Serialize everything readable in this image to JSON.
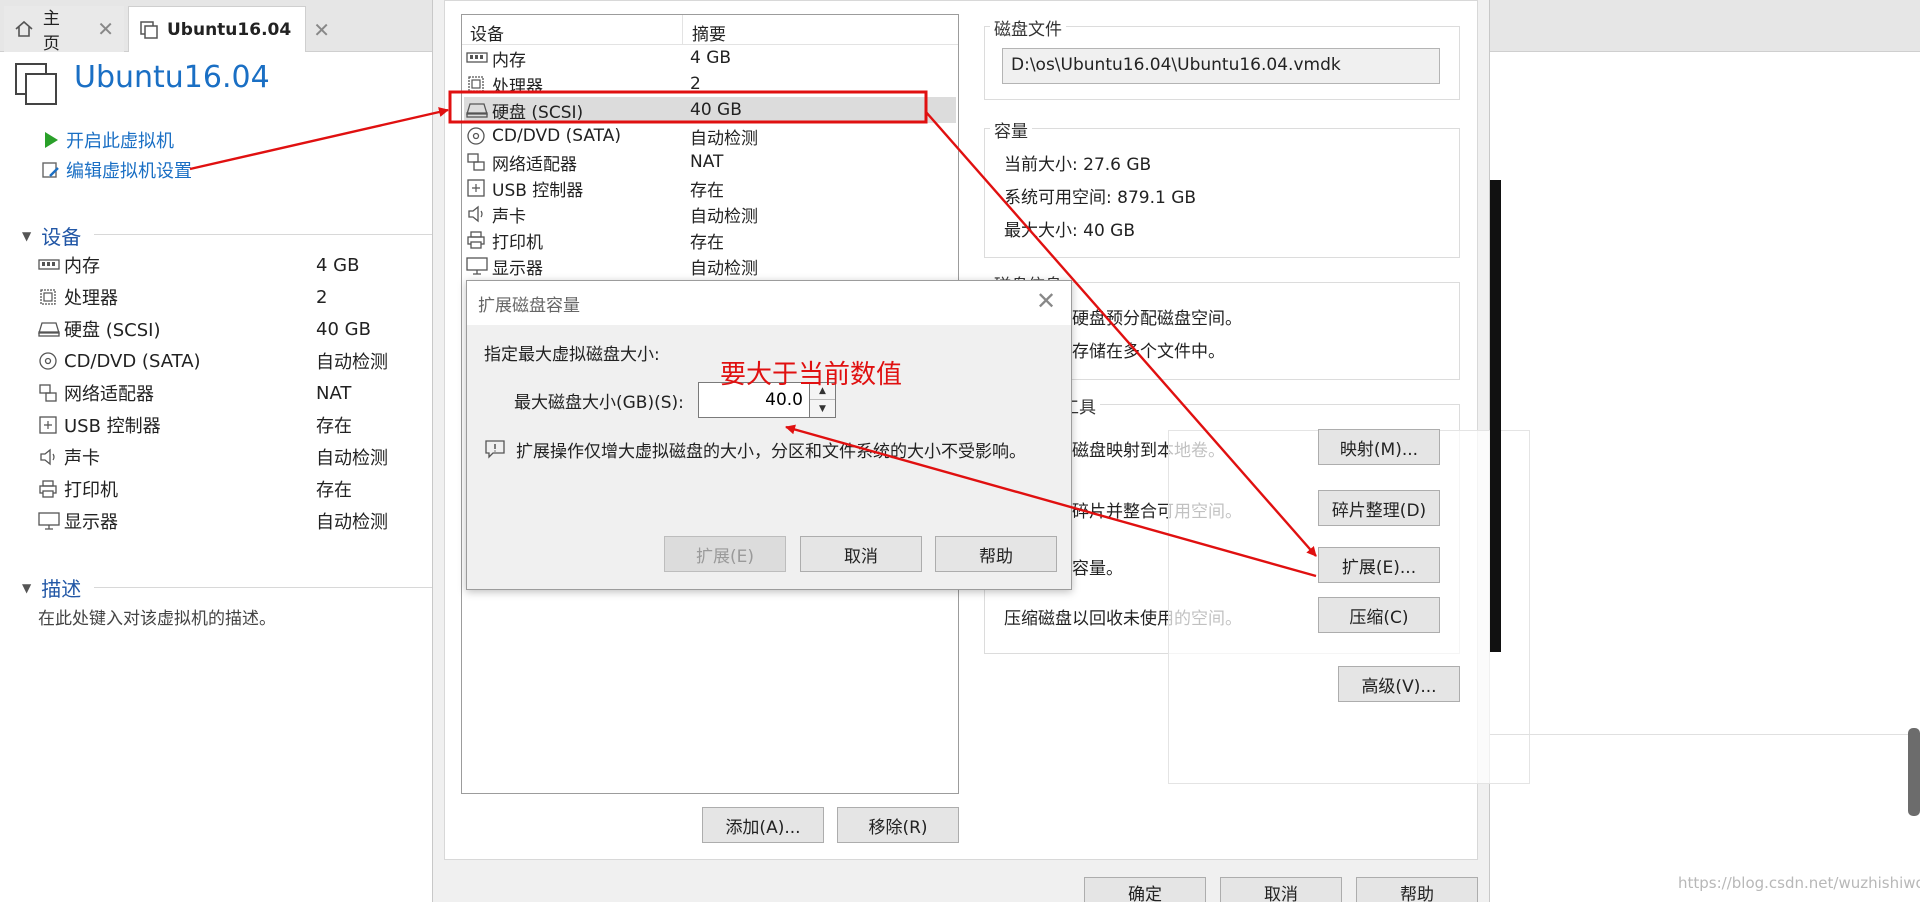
{
  "tabs": [
    {
      "label": "主页",
      "icon": "home-icon"
    },
    {
      "label": "Ubuntu16.04",
      "icon": "vm-icon"
    }
  ],
  "vm": {
    "title": "Ubuntu16.04",
    "actions": [
      {
        "label": "开启此虚拟机",
        "icon": "play-icon"
      },
      {
        "label": "编辑虚拟机设置",
        "icon": "settings-icon"
      }
    ],
    "devices_title": "设备",
    "devices": [
      {
        "name": "内存",
        "value": "4 GB",
        "icon": "memory-icon"
      },
      {
        "name": "处理器",
        "value": "2",
        "icon": "cpu-icon"
      },
      {
        "name": "硬盘 (SCSI)",
        "value": "40 GB",
        "icon": "harddisk-icon"
      },
      {
        "name": "CD/DVD (SATA)",
        "value": "自动检测",
        "icon": "cd-icon"
      },
      {
        "name": "网络适配器",
        "value": "NAT",
        "icon": "network-icon"
      },
      {
        "name": "USB 控制器",
        "value": "存在",
        "icon": "usb-icon"
      },
      {
        "name": "声卡",
        "value": "自动检测",
        "icon": "sound-icon"
      },
      {
        "name": "打印机",
        "value": "存在",
        "icon": "printer-icon"
      },
      {
        "name": "显示器",
        "value": "自动检测",
        "icon": "display-icon"
      }
    ],
    "description_title": "描述",
    "description_placeholder": "在此处键入对该虚拟机的描述。"
  },
  "settings": {
    "list_header": {
      "device": "设备",
      "summary": "摘要"
    },
    "devices": [
      {
        "name": "内存",
        "value": "4 GB",
        "icon": "memory-icon"
      },
      {
        "name": "处理器",
        "value": "2",
        "icon": "cpu-icon"
      },
      {
        "name": "硬盘 (SCSI)",
        "value": "40 GB",
        "icon": "harddisk-icon",
        "selected": true
      },
      {
        "name": "CD/DVD (SATA)",
        "value": "自动检测",
        "icon": "cd-icon"
      },
      {
        "name": "网络适配器",
        "value": "NAT",
        "icon": "network-icon"
      },
      {
        "name": "USB 控制器",
        "value": "存在",
        "icon": "usb-icon"
      },
      {
        "name": "声卡",
        "value": "自动检测",
        "icon": "sound-icon"
      },
      {
        "name": "打印机",
        "value": "存在",
        "icon": "printer-icon"
      },
      {
        "name": "显示器",
        "value": "自动检测",
        "icon": "display-icon"
      }
    ],
    "add_button": "添加(A)...",
    "remove_button": "移除(R)",
    "disk_file_title": "磁盘文件",
    "disk_file_path": "D:\\os\\Ubuntu16.04\\Ubuntu16.04.vmdk",
    "capacity_title": "容量",
    "current_size": "当前大小: 27.6 GB",
    "free_space": "系统可用空间: 879.1 GB",
    "max_size": "最大大小: 40 GB",
    "disk_info_title": "磁盘信息",
    "disk_info_1": "没有为此硬盘预分配磁盘空间。",
    "disk_info_2": "硬盘内容存储在多个文件中。",
    "disk_tools_title": "磁盘实用工具",
    "tool_map_text": "将虚拟机磁盘映射到本地卷。",
    "tool_defrag_text": "整理文件碎片并整合可用空间。",
    "tool_expand_text": "扩展磁盘容量。",
    "tool_compact_text": "压缩磁盘以回收未使用的空间。",
    "map_button": "映射(M)...",
    "defrag_button": "碎片整理(D)",
    "expand_button": "扩展(E)...",
    "compact_button": "压缩(C)",
    "advanced_button": "高级(V)...",
    "ok_button": "确定",
    "cancel_button": "取消",
    "help_button": "帮助"
  },
  "expand_dialog": {
    "title": "扩展磁盘容量",
    "prompt": "指定最大虚拟磁盘大小:",
    "field_label": "最大磁盘大小(GB)(S):",
    "field_value": "40.0",
    "note": "扩展操作仅增大虚拟磁盘的大小，分区和文件系统的大小不受影响。",
    "expand_button": "扩展(E)",
    "cancel_button": "取消",
    "help_button": "帮助"
  },
  "annotation": {
    "text": "要大于当前数值",
    "color": "#e01010"
  },
  "watermark": "https://blog.csdn.net/wuzhishiwo",
  "colors": {
    "link": "#1a6fc4",
    "annotation_red": "#e01010",
    "selection": "#dcdcdc"
  }
}
